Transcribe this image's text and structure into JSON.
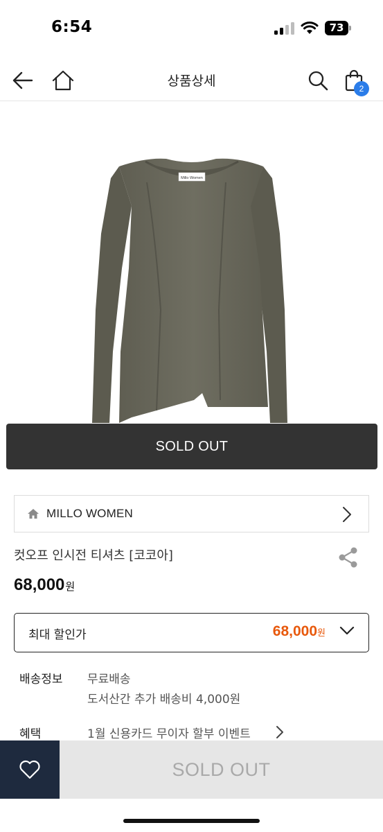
{
  "status_bar": {
    "time": "6:54",
    "battery": "73"
  },
  "header": {
    "title": "상품상세",
    "cart_count": "2"
  },
  "product": {
    "image_label_text": "Millo Women",
    "sold_out_overlay": "SOLD OUT",
    "brand": "MILLO WOMEN",
    "name": "컷오프 인시전 티셔츠 [코코아]",
    "price": "68,000",
    "price_unit": "원"
  },
  "discount": {
    "label": "최대 할인가",
    "price": "68,000",
    "unit": "원"
  },
  "shipping": {
    "label": "배송정보",
    "line1": "무료배송",
    "line2": "도서산간 추가 배송비 4,000원"
  },
  "benefit": {
    "label": "혜택",
    "text": "1월 신용카드 무이자 할부 이벤트"
  },
  "bottom": {
    "sold_out_button": "SOLD OUT"
  },
  "colors": {
    "garment": "#6b6a5d",
    "accent": "#e8590c",
    "badge": "#2b7de9",
    "wish_bg": "#1e2a3e"
  },
  "icons": [
    "back-arrow-icon",
    "home-icon",
    "search-icon",
    "cart-icon",
    "chevron-right-icon",
    "share-icon",
    "chevron-down-icon",
    "heart-icon"
  ]
}
